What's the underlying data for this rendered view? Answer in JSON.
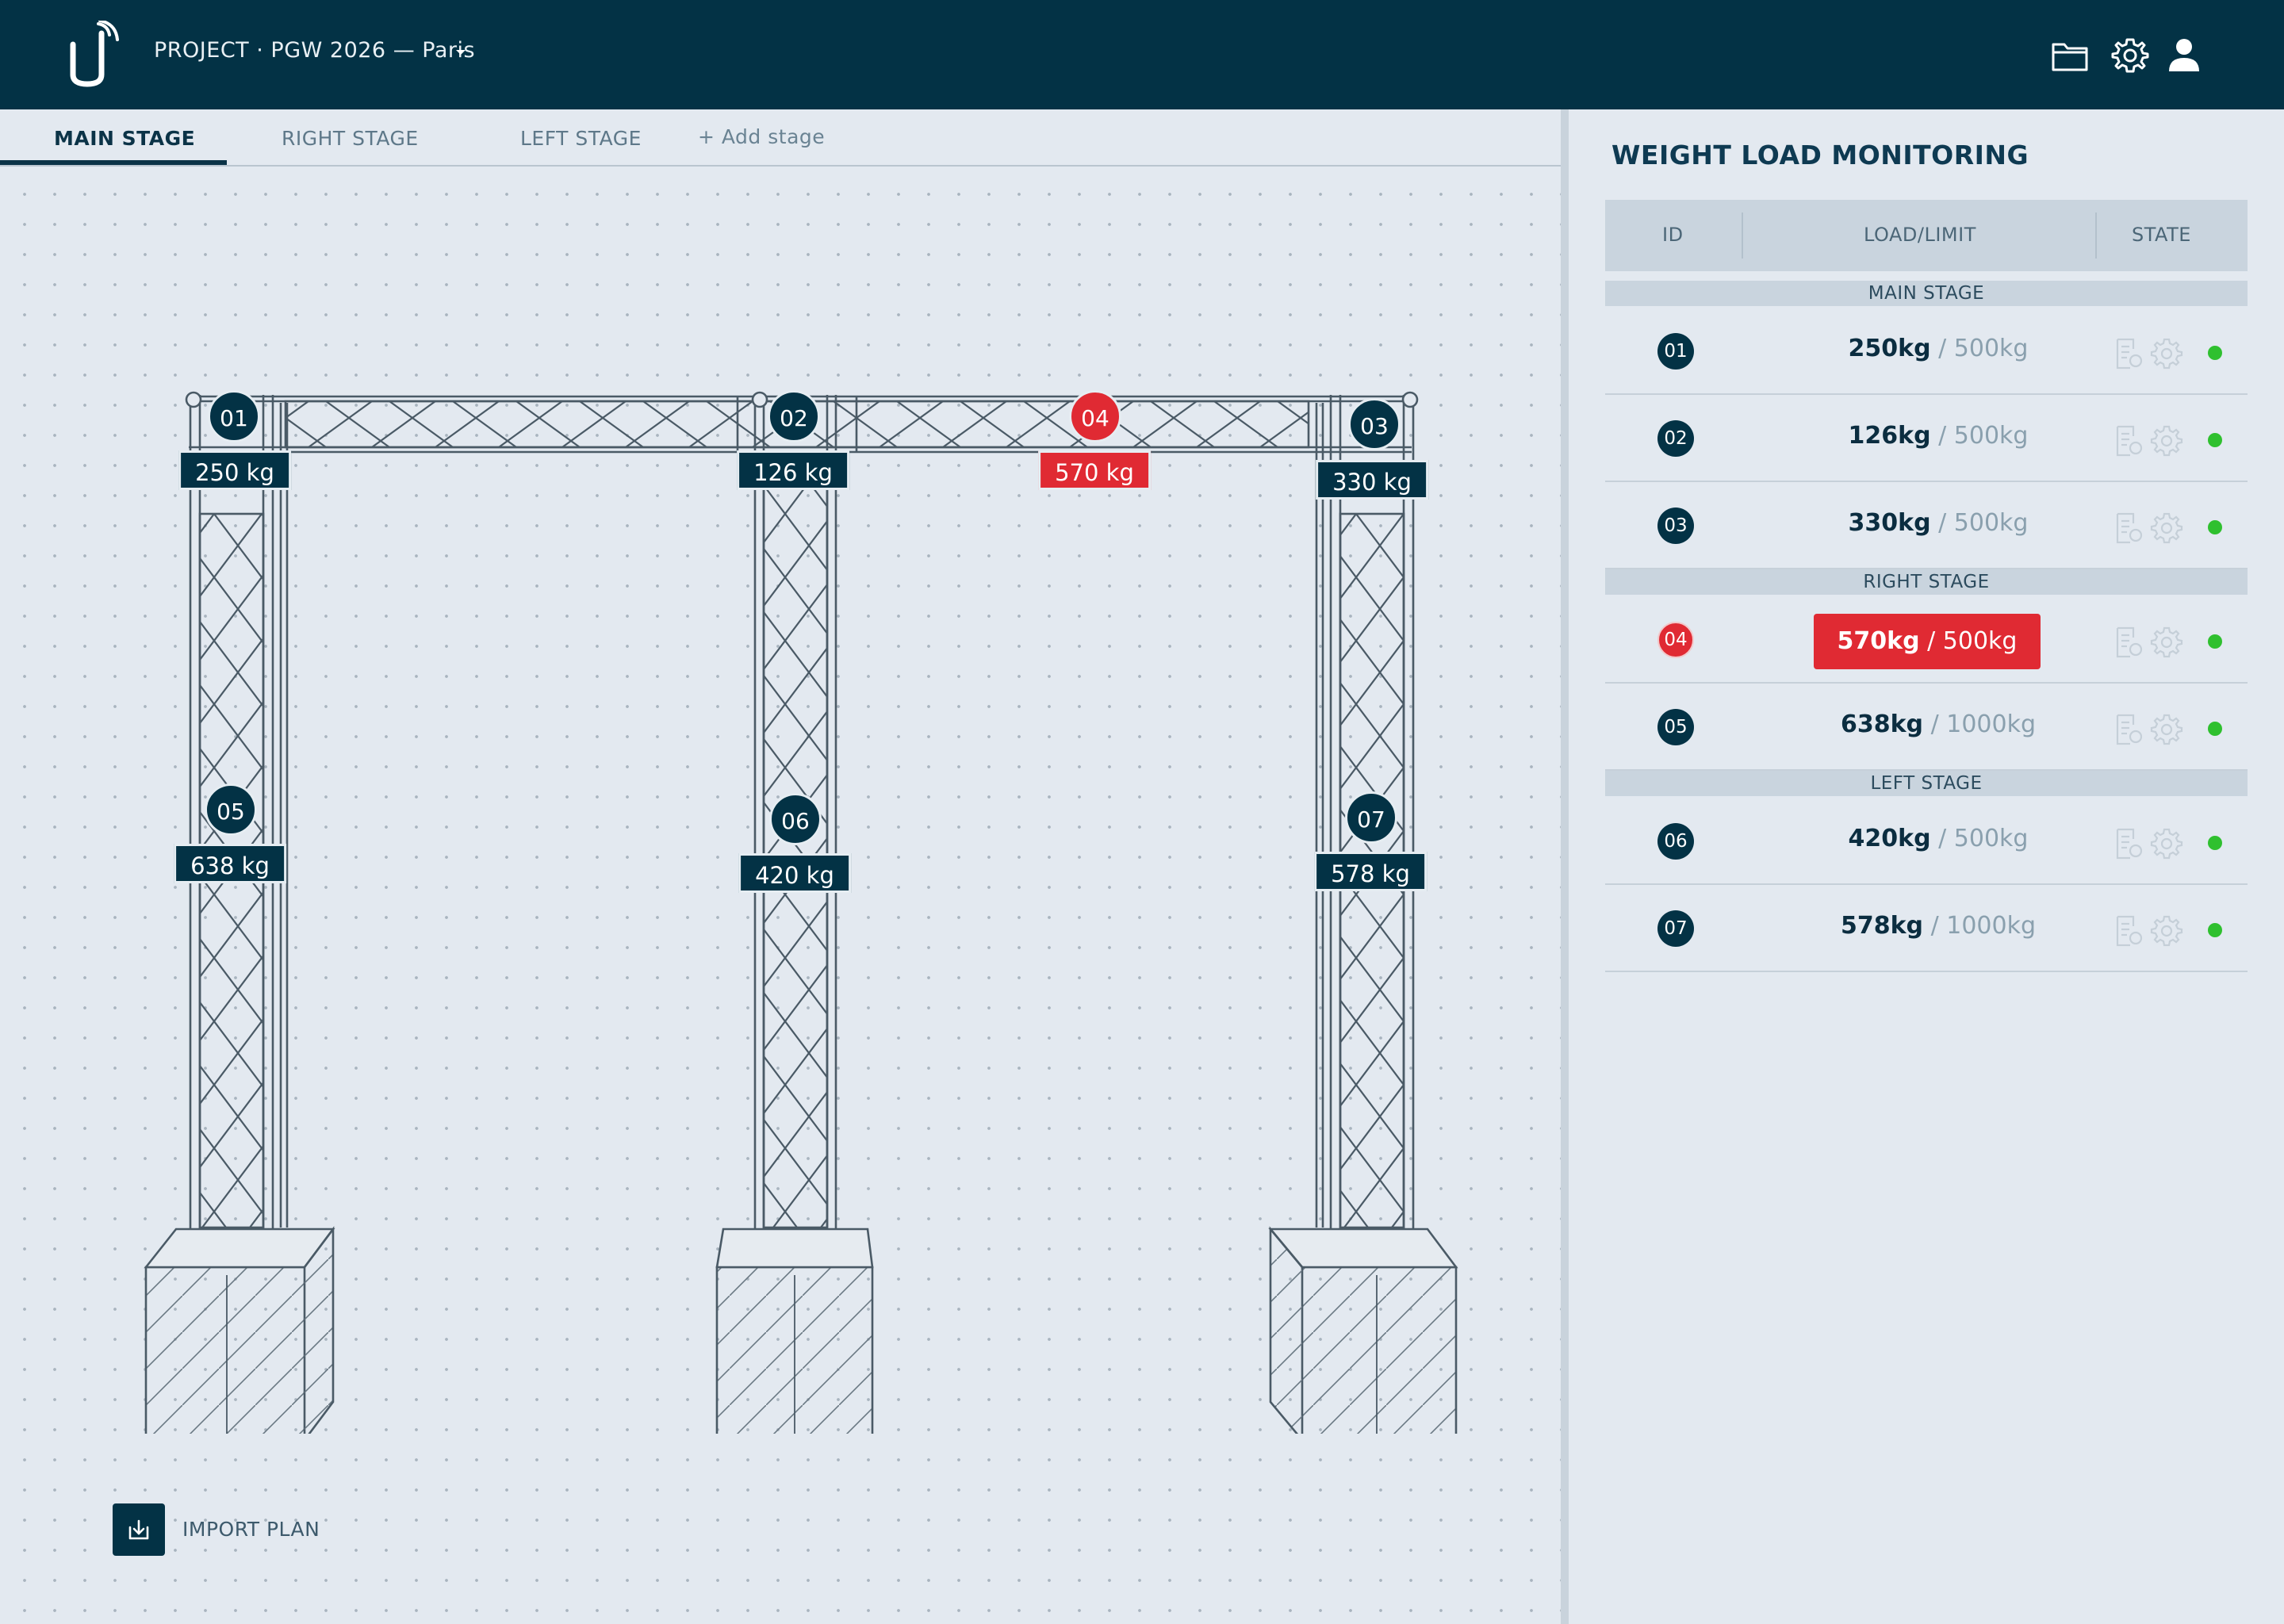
{
  "header": {
    "project_title": "PROJECT · PGW 2026 — Paris",
    "icons": [
      "folder-icon",
      "gear-icon",
      "user-icon"
    ]
  },
  "tabs": [
    {
      "label": "MAIN STAGE",
      "active": true
    },
    {
      "label": "RIGHT STAGE",
      "active": false
    },
    {
      "label": "LEFT STAGE",
      "active": false
    }
  ],
  "add_stage_label": "+ Add stage",
  "import_plan_label": "IMPORT PLAN",
  "points": [
    {
      "id": "01",
      "load": "250 kg",
      "alert": false
    },
    {
      "id": "02",
      "load": "126 kg",
      "alert": false
    },
    {
      "id": "03",
      "load": "330 kg",
      "alert": false
    },
    {
      "id": "04",
      "load": "570 kg",
      "alert": true
    },
    {
      "id": "05",
      "load": "638 kg",
      "alert": false
    },
    {
      "id": "06",
      "load": "420 kg",
      "alert": false
    },
    {
      "id": "07",
      "load": "578 kg",
      "alert": false
    }
  ],
  "monitor": {
    "title": "WEIGHT LOAD MONITORING",
    "columns": [
      "ID",
      "LOAD/LIMIT",
      "STATE"
    ],
    "sections": [
      {
        "name": "MAIN STAGE",
        "rows": [
          {
            "id": "01",
            "load": "250kg",
            "limit": " / 500kg",
            "alert": false,
            "state": "ok"
          },
          {
            "id": "02",
            "load": "126kg",
            "limit": " / 500kg",
            "alert": false,
            "state": "ok"
          },
          {
            "id": "03",
            "load": "330kg",
            "limit": " / 500kg",
            "alert": false,
            "state": "ok"
          }
        ]
      },
      {
        "name": "RIGHT STAGE",
        "rows": [
          {
            "id": "04",
            "load": "570kg",
            "limit": " / 500kg",
            "alert": true,
            "state": "ok"
          },
          {
            "id": "05",
            "load": "638kg",
            "limit": " / 1000kg",
            "alert": false,
            "state": "ok"
          }
        ]
      },
      {
        "name": "LEFT STAGE",
        "rows": [
          {
            "id": "06",
            "load": "420kg",
            "limit": " / 500kg",
            "alert": false,
            "state": "ok"
          },
          {
            "id": "07",
            "load": "578kg",
            "limit": " / 1000kg",
            "alert": false,
            "state": "ok"
          }
        ]
      }
    ]
  },
  "colors": {
    "header_bg": "#033245",
    "accent": "#033245",
    "alert": "#e02a33",
    "ok": "#2fc02f"
  }
}
